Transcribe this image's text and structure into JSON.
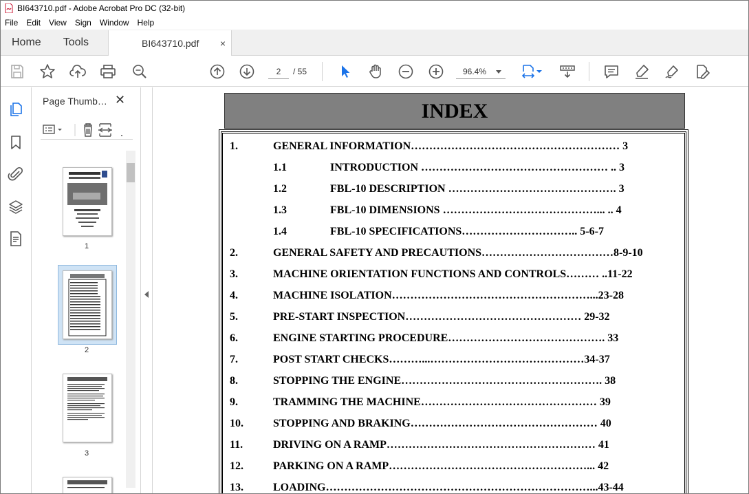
{
  "window": {
    "title": "BI643710.pdf - Adobe Acrobat Pro DC (32-bit)"
  },
  "menu": [
    "File",
    "Edit",
    "View",
    "Sign",
    "Window",
    "Help"
  ],
  "tabs": {
    "home": "Home",
    "tools": "Tools",
    "document": "BI643710.pdf",
    "close": "×"
  },
  "toolbar": {
    "current_page": "2",
    "total_pages": "/ 55",
    "zoom": "96.4%"
  },
  "thumbnails": {
    "panel_title": "Page Thumb…",
    "close": "✕",
    "pages": [
      {
        "label": "1"
      },
      {
        "label": "2",
        "selected": true
      },
      {
        "label": "3"
      }
    ]
  },
  "document": {
    "heading": "INDEX",
    "entries": [
      {
        "num": "1.",
        "text": "GENERAL INFORMATION…………………………………………………  3",
        "sub": false
      },
      {
        "num": "1.1",
        "text": "INTRODUCTION …………………………………………… ..  3",
        "sub": true
      },
      {
        "num": "1.2",
        "text": "FBL-10 DESCRIPTION ……………………………………….  3",
        "sub": true
      },
      {
        "num": "1.3",
        "text": "FBL-10 DIMENSIONS ……………………………………... .. 4",
        "sub": true
      },
      {
        "num": "1.4",
        "text": "FBL-10 SPECIFICATIONS…………………………..  5-6-7",
        "sub": true
      },
      {
        "num": "2.",
        "text": "GENERAL SAFETY AND PRECAUTIONS………………………………8-9-10",
        "sub": false
      },
      {
        "num": "3.",
        "text": "MACHINE ORIENTATION FUNCTIONS AND CONTROLS……… ..11-22",
        "sub": false
      },
      {
        "num": "4.",
        "text": "MACHINE ISOLATION………………………………………………...23-28",
        "sub": false
      },
      {
        "num": "5.",
        "text": "PRE-START INSPECTION………………………………………… 29-32",
        "sub": false
      },
      {
        "num": "6.",
        "text": "ENGINE STARTING PROCEDURE……………………………………. 33",
        "sub": false
      },
      {
        "num": "7.",
        "text": "POST START CHECKS………...……………………………………34-37",
        "sub": false
      },
      {
        "num": "8.",
        "text": "STOPPING THE ENGINE………………………………………………. 38",
        "sub": false
      },
      {
        "num": "9.",
        "text": "TRAMMING THE MACHINE…………………………………………  39",
        "sub": false
      },
      {
        "num": "10.",
        "text": "STOPPING AND BRAKING……………………………………………  40",
        "sub": false
      },
      {
        "num": "11.",
        "text": "DRIVING ON A RAMP…………………………………………………  41",
        "sub": false
      },
      {
        "num": "12.",
        "text": "PARKING ON A RAMP………………………………………………...  42",
        "sub": false
      },
      {
        "num": "13.",
        "text": "LOADING………………………………………………………………...43-44",
        "sub": false
      }
    ]
  }
}
